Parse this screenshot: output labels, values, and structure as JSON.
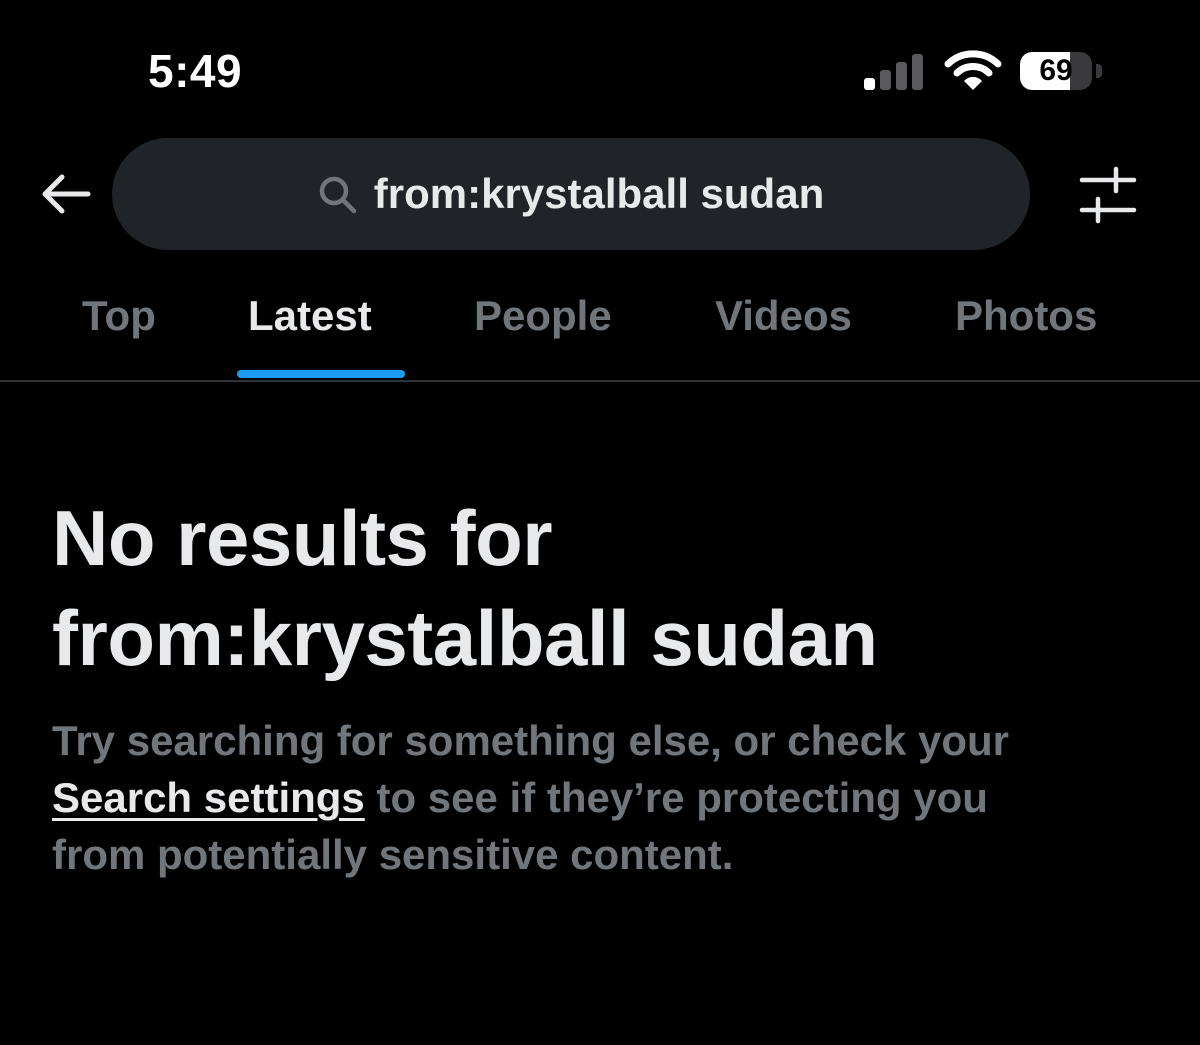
{
  "status_bar": {
    "time": "5:49",
    "battery_percent": "69",
    "battery_level": 0.69,
    "signal_bars_active": 1,
    "signal_bars_total": 4,
    "icons": [
      "cellular-signal-icon",
      "wifi-icon",
      "battery-icon"
    ]
  },
  "header": {
    "back_icon": "arrow-left-icon",
    "search_icon": "magnifier-icon",
    "search_query": "from:krystalball sudan",
    "filter_icon": "sliders-icon"
  },
  "tabs": [
    {
      "label": "Top",
      "active": false
    },
    {
      "label": "Latest",
      "active": true
    },
    {
      "label": "People",
      "active": false
    },
    {
      "label": "Videos",
      "active": false
    },
    {
      "label": "Photos",
      "active": false
    }
  ],
  "empty_state": {
    "title_line1": "No results for",
    "title_line2": "from:krystalball sudan",
    "desc_line1": "Try searching for something else, or check your",
    "link_text": "Search settings",
    "desc_line2_rest": " to see if they’re protecting you",
    "desc_line3": "from potentially sensitive content."
  },
  "colors": {
    "background": "#000000",
    "text_primary": "#e7e9ea",
    "text_secondary": "#71767b",
    "search_bg": "#202327",
    "accent": "#1d9bf0",
    "divider": "#2f3336"
  }
}
